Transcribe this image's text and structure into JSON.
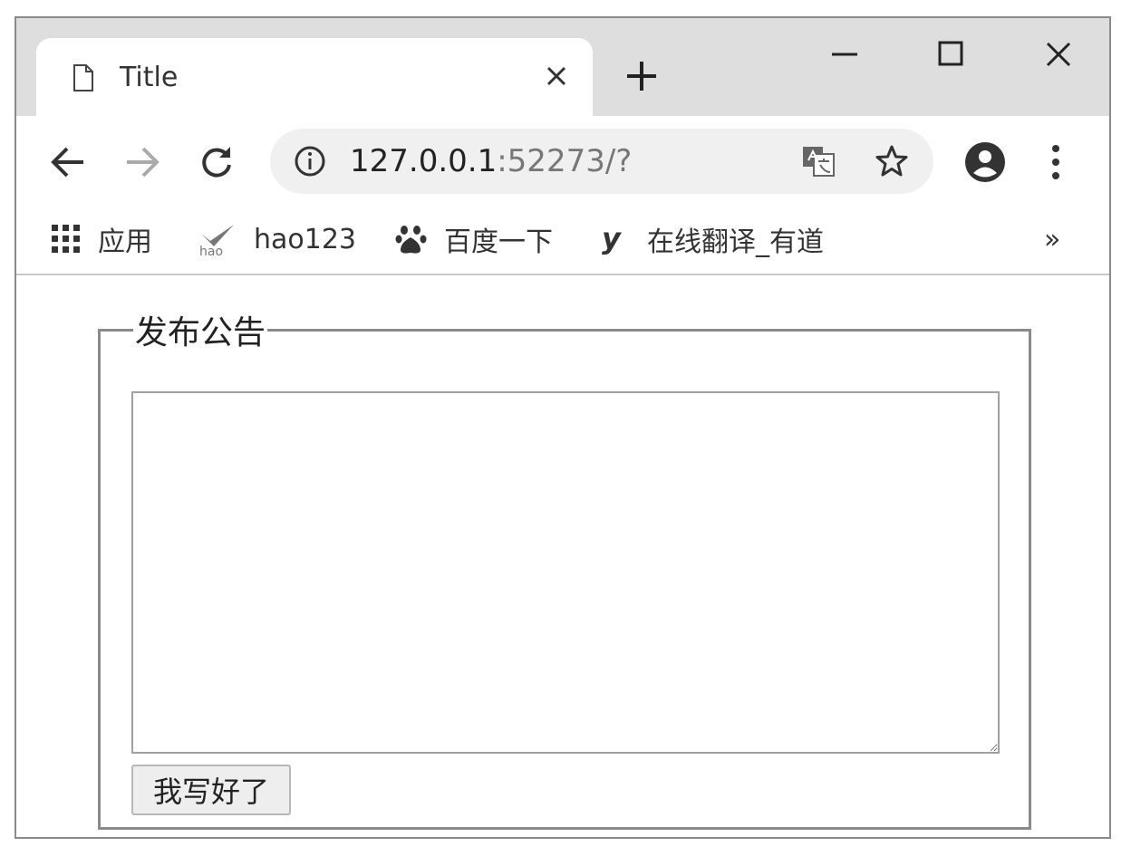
{
  "tab": {
    "title": "Title"
  },
  "address_bar": {
    "host": "127.0.0.1",
    "rest": ":52273/?"
  },
  "bookmarks": [
    {
      "label": "应用",
      "icon": "apps-grid-icon"
    },
    {
      "label": "hao123",
      "icon": "hao123-icon"
    },
    {
      "label": "百度一下",
      "icon": "baidu-paw-icon"
    },
    {
      "label": "在线翻译_有道",
      "icon": "youdao-icon"
    }
  ],
  "bookmarks_overflow": "»",
  "form": {
    "legend": "发布公告",
    "textarea_value": "",
    "submit_label": "我写好了"
  }
}
